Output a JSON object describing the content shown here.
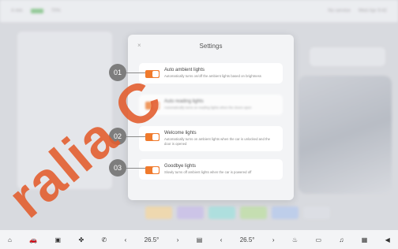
{
  "statusbar": {
    "left_text": "4 min",
    "battery": "70%",
    "right_items": [
      "No service",
      "Wed Apr 9:42"
    ]
  },
  "modal": {
    "title": "Settings",
    "close_glyph": "×"
  },
  "settings": [
    {
      "title": "Auto ambient lights",
      "desc": "Automatically turns on/off the ambient lights based on brightness"
    },
    {
      "title": "Auto reading lights",
      "desc": "Automatically turns on reading lights when the doors open"
    },
    {
      "title": "Welcome lights",
      "desc": "Automatically turns on ambient lights when the car is unlocked and the door is opened"
    },
    {
      "title": "Goodbye lights",
      "desc": "Slowly turns off ambient lights when the car is powered off"
    }
  ],
  "markers": [
    "01",
    "02",
    "03"
  ],
  "dock": {
    "left_temp": "26.5°",
    "right_temp": "26.5°",
    "icons": [
      "home-icon",
      "car-icon",
      "seat-icon",
      "fan-icon",
      "phone-icon",
      "music-icon",
      "apps-icon",
      "volume-icon"
    ]
  },
  "watermark": "ralia C",
  "colors": {
    "accent": "#f07a2c",
    "watermark": "#e25e30"
  }
}
